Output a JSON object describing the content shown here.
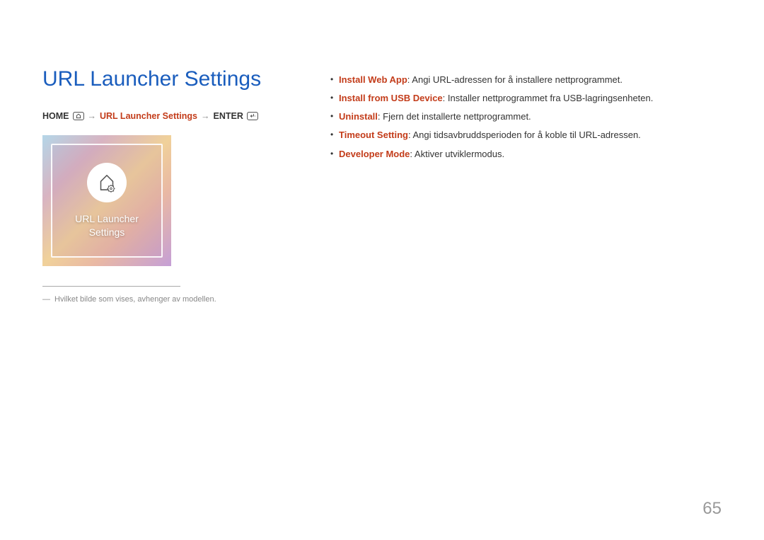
{
  "title": "URL Launcher Settings",
  "breadcrumb": {
    "home": "HOME",
    "arrow1": "→",
    "middle": "URL Launcher Settings",
    "arrow2": "→",
    "enter": "ENTER"
  },
  "thumb": {
    "line1": "URL Launcher",
    "line2": "Settings"
  },
  "footnote": {
    "dash": "―",
    "text": "Hvilket bilde som vises, avhenger av modellen."
  },
  "bullets": [
    {
      "key": "Install Web App",
      "desc": ": Angi URL-adressen for å installere nettprogrammet."
    },
    {
      "key": "Install from USB Device",
      "desc": ": Installer nettprogrammet fra USB-lagringsenheten."
    },
    {
      "key": "Uninstall",
      "desc": ": Fjern det installerte nettprogrammet."
    },
    {
      "key": "Timeout Setting",
      "desc": ": Angi tidsavbruddsperioden for å koble til URL-adressen."
    },
    {
      "key": "Developer Mode",
      "desc": ": Aktiver utviklermodus."
    }
  ],
  "pageNumber": "65"
}
